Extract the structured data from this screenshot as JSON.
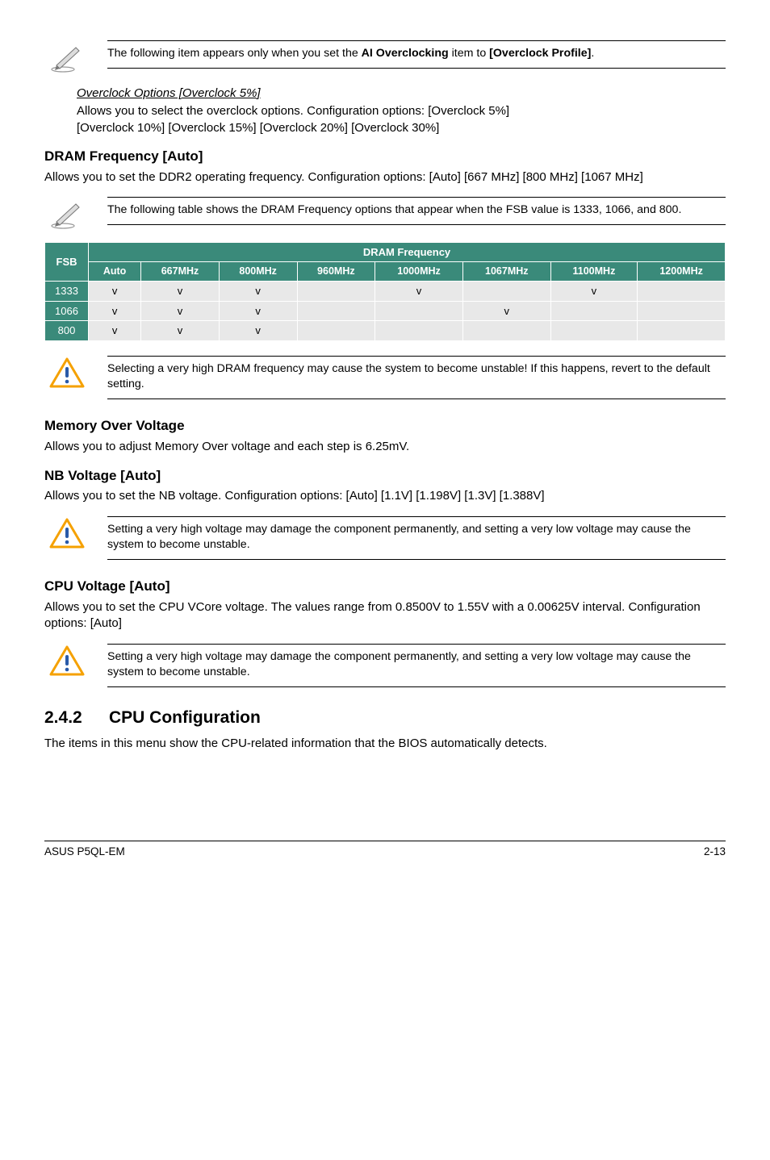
{
  "note1": {
    "prefix": "The following item appears only when you set the ",
    "bold1": "AI Overclocking",
    "mid": " item to ",
    "bold2": "[Overclock Profile]",
    "suffix": "."
  },
  "overclock": {
    "heading": "Overclock Options [Overclock 5%]",
    "line1": "Allows you to select the overclock options. Configuration options: [Overclock 5%]",
    "line2": "[Overclock 10%] [Overclock 15%] [Overclock 20%] [Overclock 30%]"
  },
  "dram": {
    "heading": "DRAM Frequency [Auto]",
    "body": "Allows you to set the DDR2 operating frequency. Configuration options: [Auto] [667 MHz] [800 MHz] [1067 MHz]"
  },
  "note2": "The following table shows the DRAM Frequency options that appear when the FSB value is 1333, 1066, and 800.",
  "table": {
    "fsb_label": "FSB",
    "dram_label": "DRAM Frequency",
    "cols": [
      "Auto",
      "667MHz",
      "800MHz",
      "960MHz",
      "1000MHz",
      "1067MHz",
      "1100MHz",
      "1200MHz"
    ],
    "rows": [
      {
        "fsb": "1333",
        "cells": [
          "v",
          "v",
          "v",
          "",
          "v",
          "",
          "v",
          ""
        ]
      },
      {
        "fsb": "1066",
        "cells": [
          "v",
          "v",
          "v",
          "",
          "",
          "v",
          "",
          ""
        ]
      },
      {
        "fsb": "800",
        "cells": [
          "v",
          "v",
          "v",
          "",
          "",
          "",
          "",
          ""
        ]
      }
    ]
  },
  "warn1": "Selecting a very high DRAM frequency may cause the system to become unstable! If this happens, revert to the default setting.",
  "memov": {
    "heading": "Memory Over Voltage",
    "body": "Allows you to adjust Memory Over voltage and each step is 6.25mV."
  },
  "nbv": {
    "heading": "NB Voltage [Auto]",
    "body": "Allows you to set the NB voltage. Configuration options: [Auto] [1.1V] [1.198V] [1.3V] [1.388V]"
  },
  "warn2": "Setting a very high voltage may damage the component permanently, and setting a very low voltage may cause the system to become unstable.",
  "cpuv": {
    "heading": "CPU Voltage [Auto]",
    "body": "Allows you to set the CPU VCore voltage. The values range from 0.8500V to 1.55V with a 0.00625V interval. Configuration options: [Auto]"
  },
  "warn3": "Setting a very high voltage may damage the component permanently, and setting a very low voltage may cause the system to become unstable.",
  "cpuconf": {
    "num": "2.4.2",
    "title": "CPU Configuration",
    "body": "The items in this menu show the CPU-related information that the BIOS automatically detects."
  },
  "footer": {
    "left": "ASUS P5QL-EM",
    "right": "2-13"
  }
}
